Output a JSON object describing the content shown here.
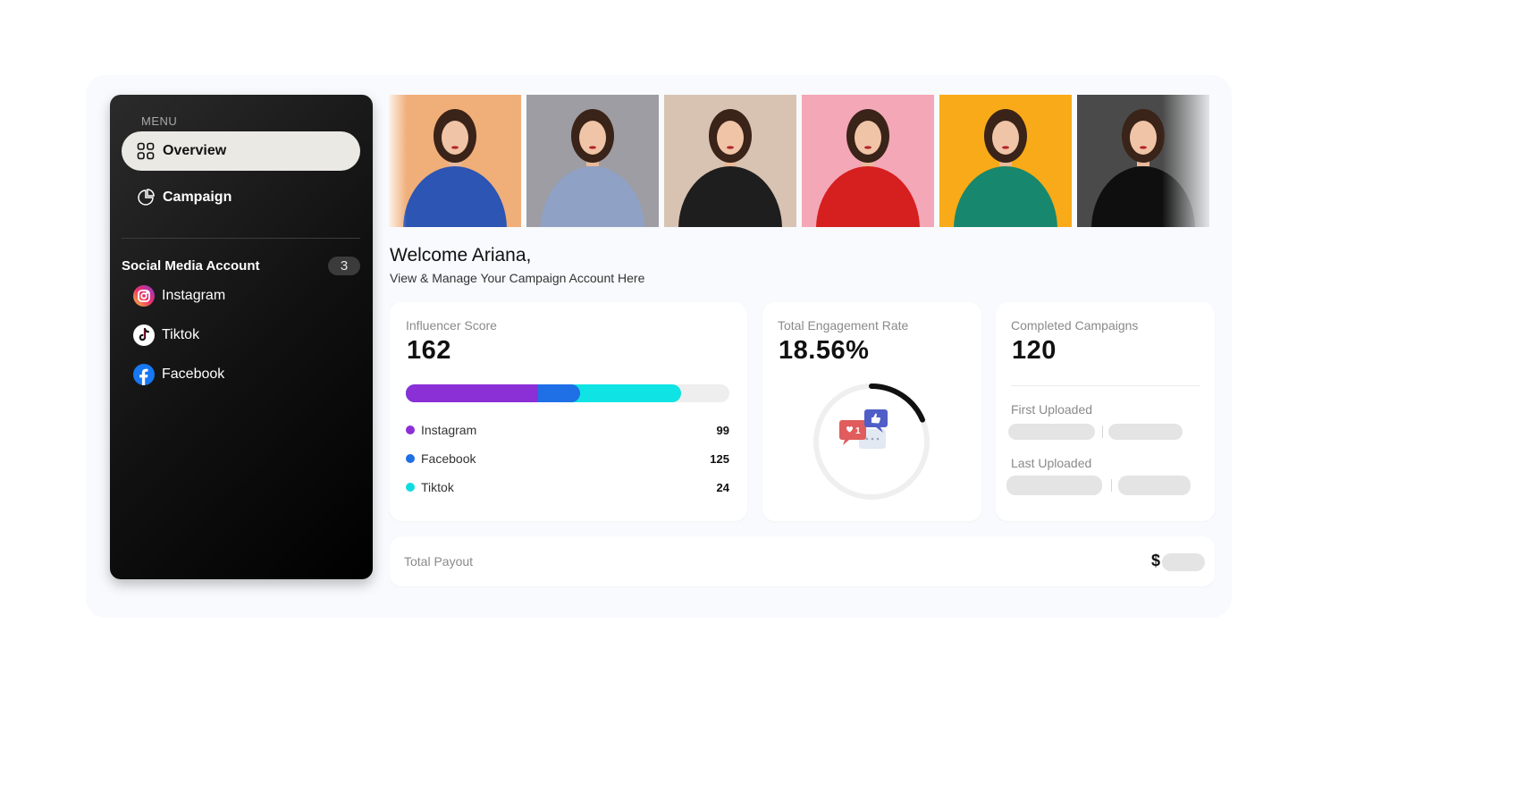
{
  "sidebar": {
    "menu_label": "MENU",
    "nav": [
      {
        "label": "Overview",
        "icon": "grid-icon",
        "active": true
      },
      {
        "label": "Campaign",
        "icon": "campaign-icon",
        "active": false
      }
    ],
    "social_title": "Social Media Account",
    "social_count": "3",
    "social": [
      {
        "label": "Instagram",
        "icon": "instagram-icon"
      },
      {
        "label": "Tiktok",
        "icon": "tiktok-icon"
      },
      {
        "label": "Facebook",
        "icon": "facebook-icon"
      }
    ]
  },
  "photos": [
    {
      "bg": "#f0ae79",
      "dress": "#2d55b3"
    },
    {
      "bg": "#9d9da3",
      "dress": "#8fa1c4"
    },
    {
      "bg": "#d8c3b3",
      "dress": "#1e1e1e"
    },
    {
      "bg": "#f4a7b6",
      "dress": "#d61f1f"
    },
    {
      "bg": "#f8aa18",
      "dress": "#17876d"
    },
    {
      "bg": "#4a4a4a",
      "dress": "#0f0f0f"
    }
  ],
  "welcome": {
    "title": "Welcome Ariana,",
    "subtitle": "View & Manage Your Campaign Account Here"
  },
  "influencer": {
    "label": "Influencer Score",
    "value": "162",
    "bar": {
      "instagram": 0.41,
      "facebook": 0.54,
      "tiktok": 0.85
    },
    "legend": [
      {
        "label": "Instagram",
        "value": "99",
        "color": "#8b2fd6"
      },
      {
        "label": "Facebook",
        "value": "125",
        "color": "#1f6fe6"
      },
      {
        "label": "Tiktok",
        "value": "24",
        "color": "#10dce0"
      }
    ]
  },
  "engagement": {
    "label": "Total Engagement Rate",
    "value": "18.56%",
    "progress": 0.1856,
    "notification_count": "1"
  },
  "campaigns": {
    "label": "Completed Campaigns",
    "value": "120",
    "first_uploaded": "First Uploaded",
    "last_uploaded": "Last Uploaded"
  },
  "payout": {
    "label": "Total Payout",
    "currency": "$"
  },
  "colors": {
    "accent_purple": "#8b2fd6",
    "accent_blue": "#1f6fe6",
    "accent_cyan": "#10dce0"
  }
}
